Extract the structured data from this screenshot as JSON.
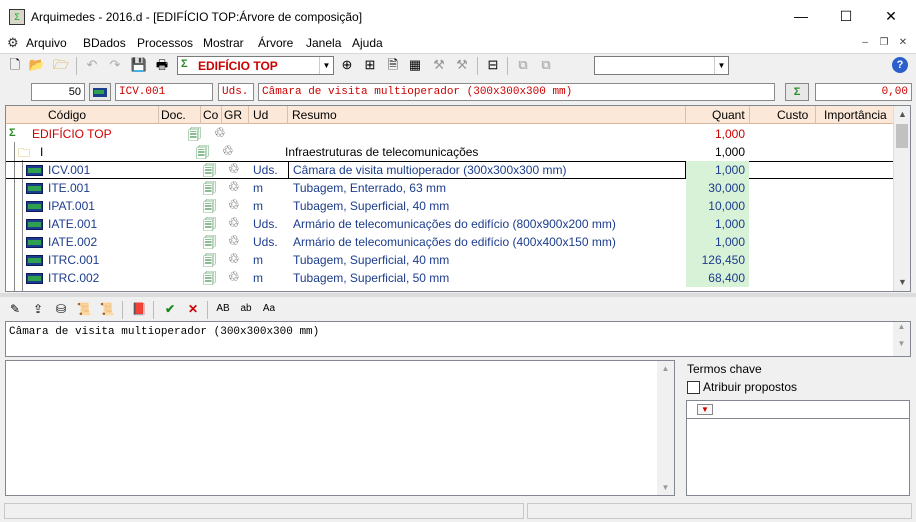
{
  "window": {
    "title": "Arquimedes - 2016.d - [EDIFÍCIO TOP:Árvore de composição]",
    "min": "—",
    "max": "☐",
    "close": "✕"
  },
  "menu": [
    "Arquivo",
    "BDados",
    "Processos",
    "Mostrar",
    "Árvore",
    "Janela",
    "Ajuda"
  ],
  "toolbar": {
    "project_combo": "EDIFÍCIO TOP",
    "right_combo": ""
  },
  "entry": {
    "number": "50",
    "code": "ICV.001",
    "unit": "Uds.",
    "summary": "Câmara de visita multioperador (300x300x300 mm)",
    "total": "0,00"
  },
  "table": {
    "headers": [
      "Código",
      "Doc.",
      "Co",
      "GR",
      "Ud",
      "Resumo",
      "Quant",
      "Custo",
      "Importância"
    ],
    "rows": [
      {
        "code": "EDIFÍCIO TOP",
        "ud": "",
        "resumo": "",
        "quant": "1,000",
        "kind": "root"
      },
      {
        "code": "I",
        "ud": "",
        "resumo": "Infraestruturas de telecomunicações",
        "quant": "1,000",
        "kind": "chapter"
      },
      {
        "code": "ICV.001",
        "ud": "Uds.",
        "resumo": "Câmara de visita multioperador (300x300x300 mm)",
        "quant": "1,000",
        "kind": "item"
      },
      {
        "code": "ITE.001",
        "ud": "m",
        "resumo": "Tubagem, Enterrado, 63 mm",
        "quant": "30,000",
        "kind": "item"
      },
      {
        "code": "IPAT.001",
        "ud": "m",
        "resumo": "Tubagem, Superficial, 40 mm",
        "quant": "10,000",
        "kind": "item"
      },
      {
        "code": "IATE.001",
        "ud": "Uds.",
        "resumo": "Armário de telecomunicações do edifício (800x900x200 mm)",
        "quant": "1,000",
        "kind": "item"
      },
      {
        "code": "IATE.002",
        "ud": "Uds.",
        "resumo": "Armário de telecomunicações do edifício (400x400x150 mm)",
        "quant": "1,000",
        "kind": "item"
      },
      {
        "code": "ITRC.001",
        "ud": "m",
        "resumo": "Tubagem, Superficial, 40 mm",
        "quant": "126,450",
        "kind": "item"
      },
      {
        "code": "ITRC.002",
        "ud": "m",
        "resumo": "Tubagem, Superficial, 50 mm",
        "quant": "68,400",
        "kind": "item"
      }
    ]
  },
  "text_panel": "Câmara de visita multioperador (300x300x300 mm)",
  "keywords": {
    "title": "Termos chave",
    "checkbox_label": "Atribuir propostos"
  },
  "colors": {
    "accent_red": "#cc0000",
    "code_blue": "#1c3c8c",
    "header_bg": "#fbe8d8",
    "quant_green": "#d8f2d8"
  }
}
